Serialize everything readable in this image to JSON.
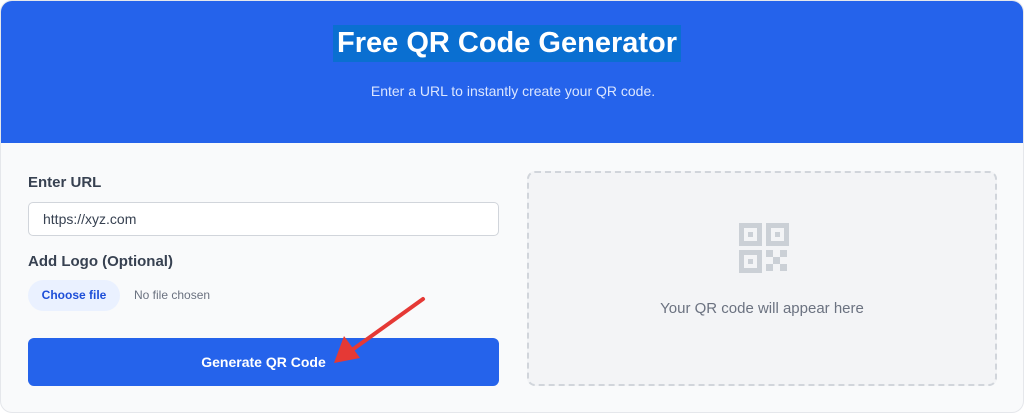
{
  "header": {
    "title": "Free QR Code Generator",
    "subtitle": "Enter a URL to instantly create your QR code."
  },
  "form": {
    "url_label": "Enter URL",
    "url_value": "https://xyz.com",
    "logo_label": "Add Logo (Optional)",
    "choose_file_label": "Choose file",
    "file_status": "No file chosen",
    "generate_label": "Generate QR Code"
  },
  "preview": {
    "placeholder_text": "Your QR code will appear here",
    "icon": "qr-code-icon"
  },
  "annotation": {
    "icon": "arrow-pointer",
    "color": "#e53935"
  },
  "colors": {
    "brand": "#2563eb",
    "title_highlight": "#0a6fd1"
  }
}
